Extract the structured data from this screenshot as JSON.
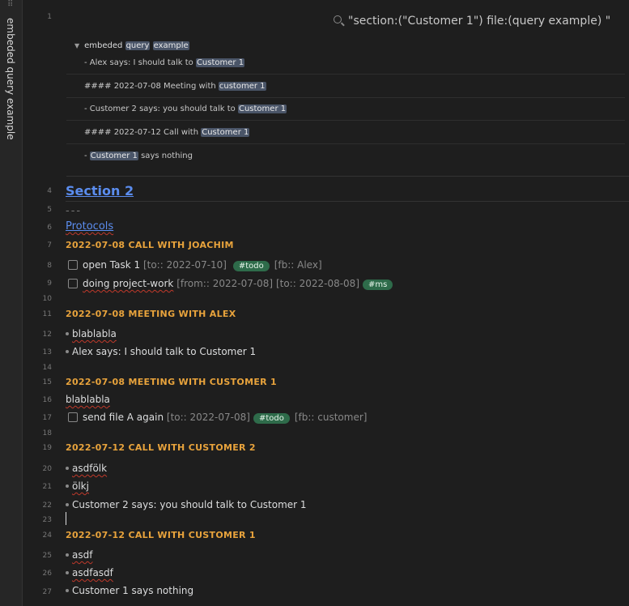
{
  "sidebar": {
    "title": "embeded query example"
  },
  "query": {
    "text": "\"section:(\"Customer 1\") file:(query example) \""
  },
  "embed": {
    "title_prefix": "embeded ",
    "title_hl1": "query",
    "title_hl2": "example",
    "results": [
      {
        "pre": "- Alex says: I should talk to ",
        "hl": "Customer 1",
        "post": ""
      },
      {
        "pre": "#### 2022-07-08 Meeting with ",
        "hl": "customer 1",
        "post": ""
      },
      {
        "pre": "- Customer 2 says: you should talk to ",
        "hl": "Customer 1",
        "post": ""
      },
      {
        "pre": "#### 2022-07-12 Call with ",
        "hl": "Customer 1",
        "post": ""
      },
      {
        "pre": "- ",
        "hl": "Customer 1",
        "post": " says nothing"
      }
    ]
  },
  "line_numbers": [
    "1",
    "4",
    "5",
    "6",
    "7",
    "8",
    "9",
    "10",
    "11",
    "12",
    "13",
    "14",
    "15",
    "16",
    "17",
    "18",
    "19",
    "20",
    "21",
    "22",
    "23",
    "24",
    "25",
    "26",
    "27"
  ],
  "doc": {
    "h2": "Section 2",
    "hr": "---",
    "h3": "Protocols",
    "h4_1": "2022-07-08 CALL WITH JOACHIM",
    "task1": {
      "text": "open Task 1",
      "field1": "[to:: 2022-07-10]",
      "tag": "#todo",
      "field2": "[fb:: Alex]"
    },
    "task2": {
      "text": "doing project-work",
      "field1": "[from:: 2022-07-08]",
      "field2": "[to:: 2022-08-08]",
      "tag": "#ms"
    },
    "h4_2": "2022-07-08 MEETING WITH ALEX",
    "b1": "blablabla",
    "b2": "Alex says: I should talk to Customer 1",
    "h4_3": "2022-07-08 MEETING WITH CUSTOMER 1",
    "p1": "blablabla",
    "task3": {
      "text": "send file A again",
      "field1": "[to:: 2022-07-08]",
      "tag": "#todo",
      "field2": "[fb:: customer]"
    },
    "h4_4": "2022-07-12 CALL WITH CUSTOMER 2",
    "b3": "asdfölk",
    "b4": "ölkj",
    "b5": "Customer 2 says: you should talk to Customer 1",
    "h4_5": "2022-07-12 CALL WITH CUSTOMER 1",
    "b6": "asdf",
    "b7": "asdfasdf",
    "b8": "Customer 1 says nothing"
  },
  "colors": {
    "heading_link": "#5b8def",
    "h4": "#e8a33c",
    "tag_bg": "#2e6b4a",
    "highlight": "#4a5568"
  }
}
